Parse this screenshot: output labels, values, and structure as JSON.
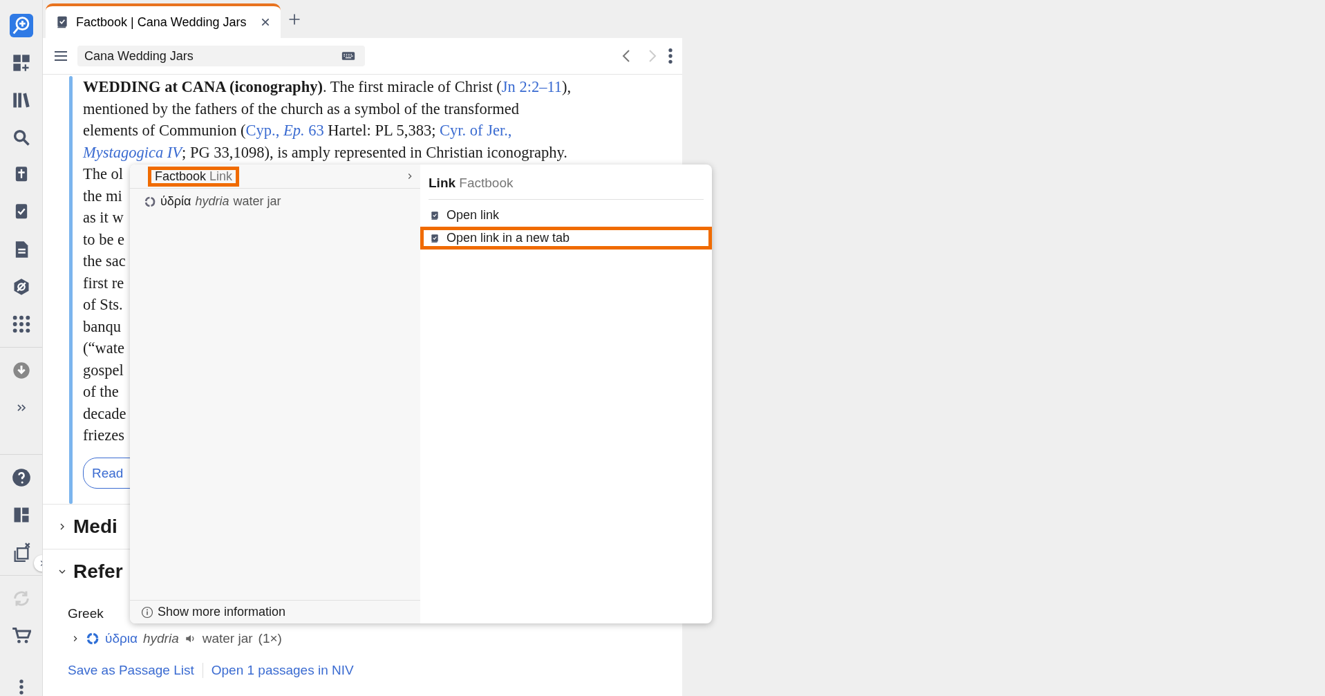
{
  "tab": {
    "title": "Factbook | Cana Wedding Jars",
    "selected": true
  },
  "toolbar": {
    "search_value": "Cana Wedding Jars",
    "back_disabled": false,
    "forward_disabled": true
  },
  "article": {
    "lines": [
      [
        {
          "kind": "text",
          "text": "**WEDDING at CANA (iconography)**. The first miracle of Christ ("
        },
        {
          "kind": "link",
          "text": "Jn 2:2–11"
        },
        {
          "kind": "text",
          "text": "),"
        }
      ],
      [
        {
          "kind": "text",
          "text": "mentioned by the fathers of the church as a symbol of the transformed"
        }
      ],
      [
        {
          "kind": "text",
          "text": "elements of Communion ("
        },
        {
          "kind": "link",
          "text": "Cyp., *Ep.* 63"
        },
        {
          "kind": "text",
          "text": " Hartel: PL 5,383; "
        },
        {
          "kind": "link",
          "text": "Cyr. of Jer.,"
        }
      ],
      [
        {
          "kind": "link",
          "text": "*Mystagogica IV*"
        },
        {
          "kind": "text",
          "text": "; PG 33,1098), is amply represented in Christian iconography."
        }
      ],
      [
        {
          "kind": "text",
          "text": "The ol"
        }
      ],
      [
        {
          "kind": "text",
          "text": "the mi"
        }
      ],
      [
        {
          "kind": "text",
          "text": "as it w"
        }
      ],
      [
        {
          "kind": "text",
          "text": "to be e"
        }
      ],
      [
        {
          "kind": "text",
          "text": "the sac"
        }
      ],
      [
        {
          "kind": "text",
          "text": "first re"
        }
      ],
      [
        {
          "kind": "text",
          "text": "of Sts."
        }
      ],
      [
        {
          "kind": "text",
          "text": "banqu"
        }
      ],
      [
        {
          "kind": "text",
          "text": "(“wate"
        }
      ],
      [
        {
          "kind": "text",
          "text": "gospel"
        }
      ],
      [
        {
          "kind": "text",
          "text": "of the"
        }
      ],
      [
        {
          "kind": "text",
          "text": "decade"
        }
      ],
      [
        {
          "kind": "text",
          "text": "friezes"
        }
      ]
    ],
    "read_more": "Read"
  },
  "sections": [
    {
      "title": "Medi",
      "expanded": false
    },
    {
      "title": "Refer",
      "expanded": true
    }
  ],
  "reference": {
    "subheading": "Greek",
    "word": {
      "expanded": false,
      "greek": "ύδρια",
      "translit": "hydria",
      "gloss": "water jar",
      "count": "(1×)"
    }
  },
  "footer_links": [
    "Save as Passage List",
    "Open 1 passages in NIV"
  ],
  "popup": {
    "left": {
      "title": "Factbook",
      "subtitle": "Link",
      "highlighted": true,
      "items": [
        {
          "greek": "ύδρία",
          "translit": "hydria",
          "gloss": "water jar"
        }
      ],
      "footer": "Show more information"
    },
    "right": {
      "title": "Link",
      "subtitle": "Factbook",
      "items": [
        {
          "label": "Open link",
          "highlighted": false
        },
        {
          "label": "Open link in a new tab",
          "highlighted": true
        }
      ]
    }
  }
}
